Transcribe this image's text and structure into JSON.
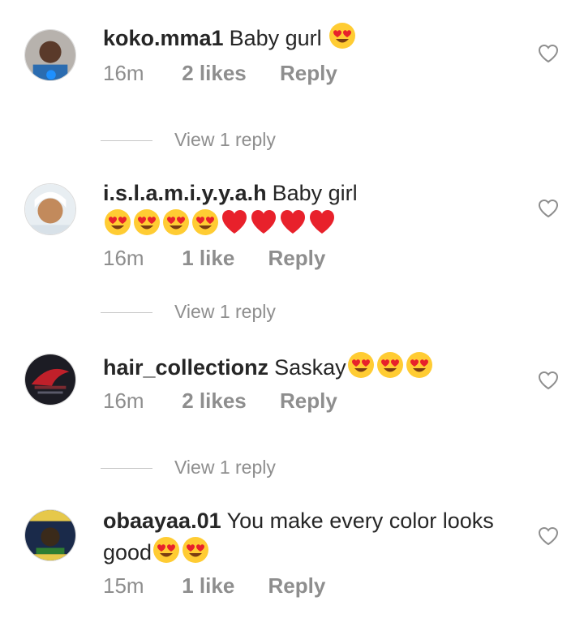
{
  "comments": [
    {
      "username": "koko.mma1",
      "text": "Baby gurl",
      "emojis": [
        "heart-eyes"
      ],
      "time": "16m",
      "likes": "2 likes",
      "reply": "Reply",
      "view_replies": "View 1 reply"
    },
    {
      "username": "i.s.l.a.m.i.y.y.a.h",
      "text": "Baby girl",
      "emojis": [
        "heart-eyes",
        "heart-eyes",
        "heart-eyes",
        "heart-eyes",
        "red-heart",
        "red-heart",
        "red-heart",
        "red-heart"
      ],
      "time": "16m",
      "likes": "1 like",
      "reply": "Reply",
      "view_replies": "View 1 reply"
    },
    {
      "username": "hair_collectionz",
      "text": "Saskay",
      "emojis": [
        "heart-eyes",
        "heart-eyes",
        "heart-eyes"
      ],
      "time": "16m",
      "likes": "2 likes",
      "reply": "Reply",
      "view_replies": "View 1 reply"
    },
    {
      "username": "obaayaa.01",
      "text": "You make every color looks good",
      "emojis": [
        "heart-eyes",
        "heart-eyes"
      ],
      "time": "15m",
      "likes": "1 like",
      "reply": "Reply"
    }
  ],
  "colors": {
    "text": "#262626",
    "meta": "#8e8e8e",
    "divider": "#c7c7c7",
    "heart_outline": "#8e8e8e",
    "emoji_face": "#ffcc33",
    "emoji_heart": "#e8212b"
  }
}
